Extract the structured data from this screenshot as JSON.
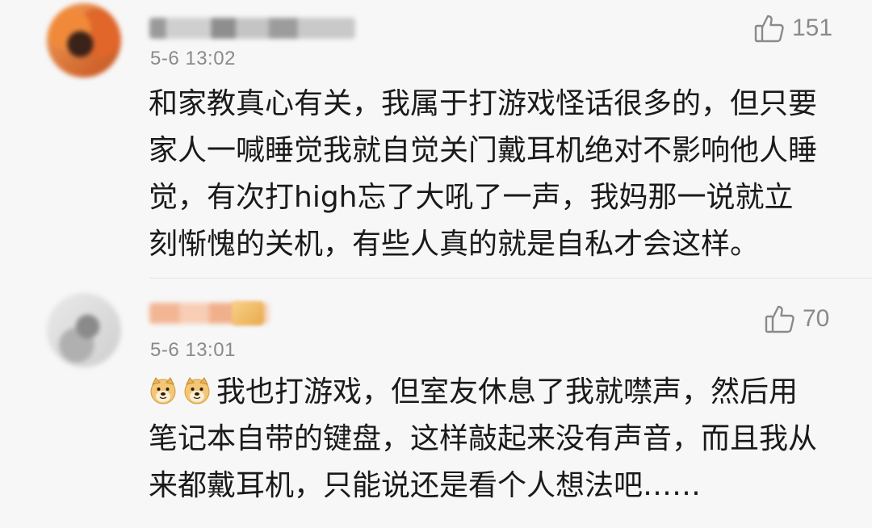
{
  "comments": [
    {
      "time": "5-6 13:02",
      "likes": "151",
      "lines": [
        "和家教真心有关，我属于打游戏怪话很多的，但只要",
        "家人一喊睡觉我就自觉关门戴耳机绝对不影响他人睡",
        "觉，有次打high忘了大吼了一声，我妈那一说就立",
        "刻惭愧的关机，有些人真的就是自私才会这样。"
      ]
    },
    {
      "time": "5-6 13:01",
      "likes": "70",
      "emoji": "doge-emoji",
      "lines": [
        "我也打游戏，但室友休息了我就噤声，然后用",
        "笔记本自带的键盘，这样敲起来没有声音，而且我从",
        "来都戴耳机，只能说还是看个人想法吧……"
      ]
    }
  ],
  "icons": {
    "like": "thumbs-up-icon"
  },
  "colors": {
    "background": "#f7f7f7",
    "text": "#1a1a1a",
    "meta": "#8a8a8a"
  }
}
